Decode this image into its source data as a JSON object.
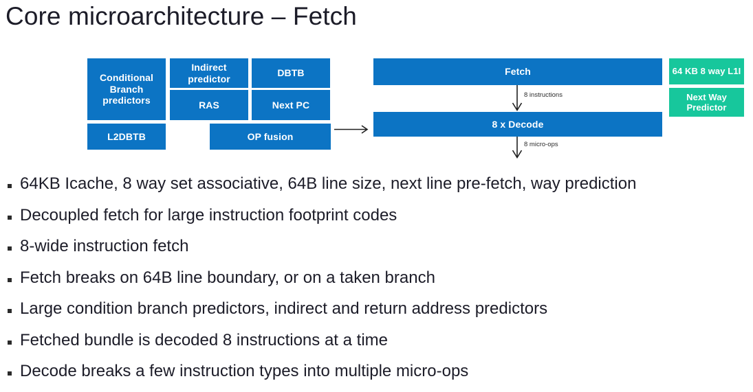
{
  "slide": {
    "title": "Core microarchitecture – Fetch",
    "background_color": "#ffffff",
    "blue_color": "#0c74c4",
    "teal_color": "#17c79c",
    "text_color": "#1c1c28"
  },
  "diagram": {
    "boxes": {
      "conditional_branch_predictors": "Conditional Branch predictors",
      "l2dbtb": "L2DBTB",
      "indirect_predictor": "Indirect predictor",
      "ras": "RAS",
      "dbtb": "DBTB",
      "next_pc": "Next PC",
      "op_fusion": "OP fusion",
      "fetch": "Fetch",
      "decode": "8 x Decode",
      "l1i": "64 KB 8 way L1I",
      "next_way_predictor": "Next Way Predictor"
    },
    "arrow_labels": {
      "instructions": "8 instructions",
      "micro_ops": "8 micro-ops"
    }
  },
  "bullets": [
    "64KB Icache, 8 way set associative, 64B line size, next line pre-fetch, way prediction",
    "Decoupled fetch for large instruction footprint codes",
    "8-wide instruction fetch",
    "Fetch breaks on 64B line boundary, or on a taken branch",
    "Large condition branch predictors, indirect and return address predictors",
    "Fetched bundle is decoded 8 instructions at a time",
    "Decode breaks a few instruction types into multiple micro-ops"
  ]
}
